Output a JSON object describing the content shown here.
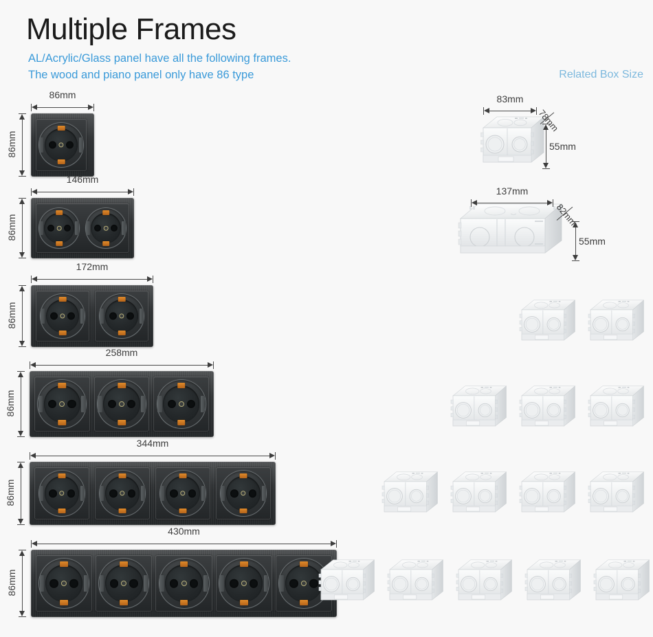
{
  "header": {
    "title": "Multiple Frames",
    "subtitle_line1": "AL/Acrylic/Glass panel have all the following frames.",
    "subtitle_line2": "The wood and piano panel only have 86 type",
    "related_box_label": "Related Box Size",
    "accent_color": "#3a9ad9",
    "related_label_color": "#7cb8dd",
    "title_color": "#1b1b1b"
  },
  "background_color": "#f8f8f8",
  "panel_color": "#303335",
  "socket_clip_color": "#e08a2a",
  "panels": [
    {
      "id": "panel-1-gang",
      "gangs": 1,
      "width_label": "86mm",
      "height_label": "86mm",
      "shared_bezel": false
    },
    {
      "id": "panel-2-gang-146",
      "gangs": 2,
      "width_label": "146mm",
      "height_label": "86mm",
      "shared_bezel": true
    },
    {
      "id": "panel-2-gang-172",
      "gangs": 2,
      "width_label": "172mm",
      "height_label": "86mm",
      "shared_bezel": false
    },
    {
      "id": "panel-3-gang",
      "gangs": 3,
      "width_label": "258mm",
      "height_label": "86mm",
      "shared_bezel": false
    },
    {
      "id": "panel-4-gang",
      "gangs": 4,
      "width_label": "344mm",
      "height_label": "86mm",
      "shared_bezel": false
    },
    {
      "id": "panel-5-gang",
      "gangs": 5,
      "width_label": "430mm",
      "height_label": "86mm",
      "shared_bezel": false
    }
  ],
  "boxes": [
    {
      "id": "box-single",
      "count": 1,
      "width_label": "83mm",
      "depth_label": "78mm",
      "height_label": "55mm",
      "dimensioned": true
    },
    {
      "id": "box-double",
      "count": 1,
      "width_label": "137mm",
      "depth_label": "82mm",
      "height_label": "55mm",
      "dimensioned": true
    },
    {
      "id": "box-row-2",
      "count": 2,
      "dimensioned": false
    },
    {
      "id": "box-row-3",
      "count": 3,
      "dimensioned": false
    },
    {
      "id": "box-row-4",
      "count": 4,
      "dimensioned": false
    },
    {
      "id": "box-row-5",
      "count": 5,
      "dimensioned": false
    }
  ]
}
